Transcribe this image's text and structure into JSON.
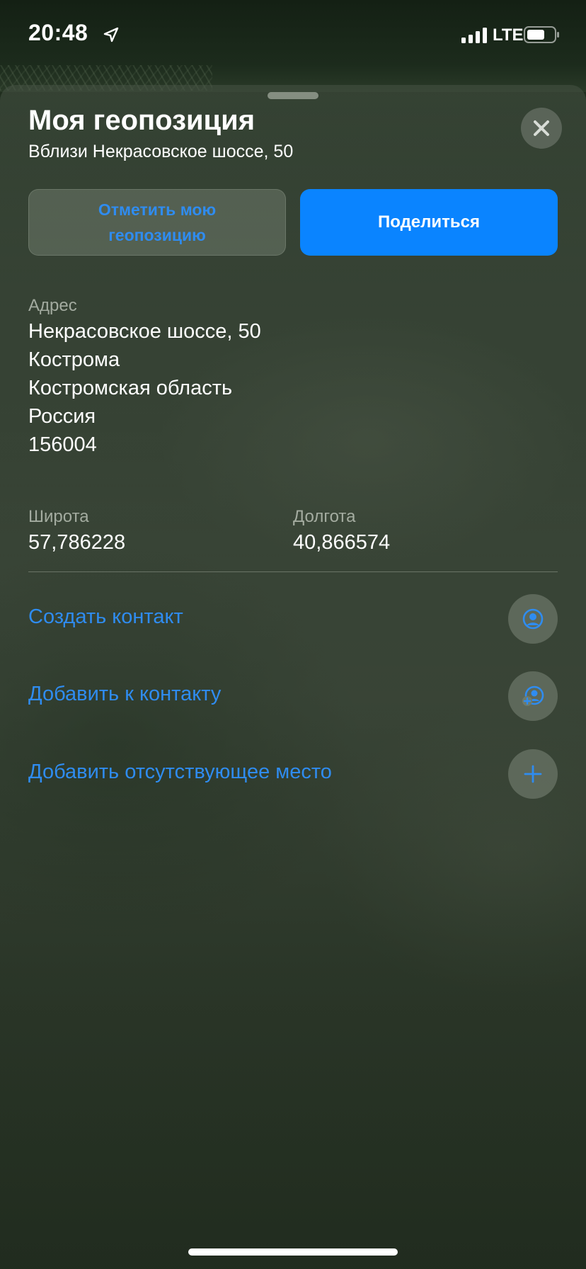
{
  "status_bar": {
    "time": "20:48",
    "network": "LTE"
  },
  "sheet": {
    "title": "Моя геопозиция",
    "subtitle": "Вблизи Некрасовское шоссе, 50"
  },
  "buttons": {
    "mark_location": "Отметить мою геопозицию",
    "share": "Поделиться"
  },
  "address": {
    "label": "Адрес",
    "lines": [
      "Некрасовское шоссе, 50",
      "Кострома",
      "Костромская область",
      "Россия",
      "156004"
    ]
  },
  "coordinates": {
    "latitude_label": "Широта",
    "latitude": "57,786228",
    "longitude_label": "Долгота",
    "longitude": "40,866574"
  },
  "actions": [
    {
      "label": "Создать контакт",
      "icon": "person-circle-icon"
    },
    {
      "label": "Добавить к контакту",
      "icon": "person-add-icon"
    },
    {
      "label": "Добавить отсутствующее место",
      "icon": "plus-icon"
    }
  ],
  "colors": {
    "accent": "#0a84ff",
    "link": "#2f8cf0"
  }
}
